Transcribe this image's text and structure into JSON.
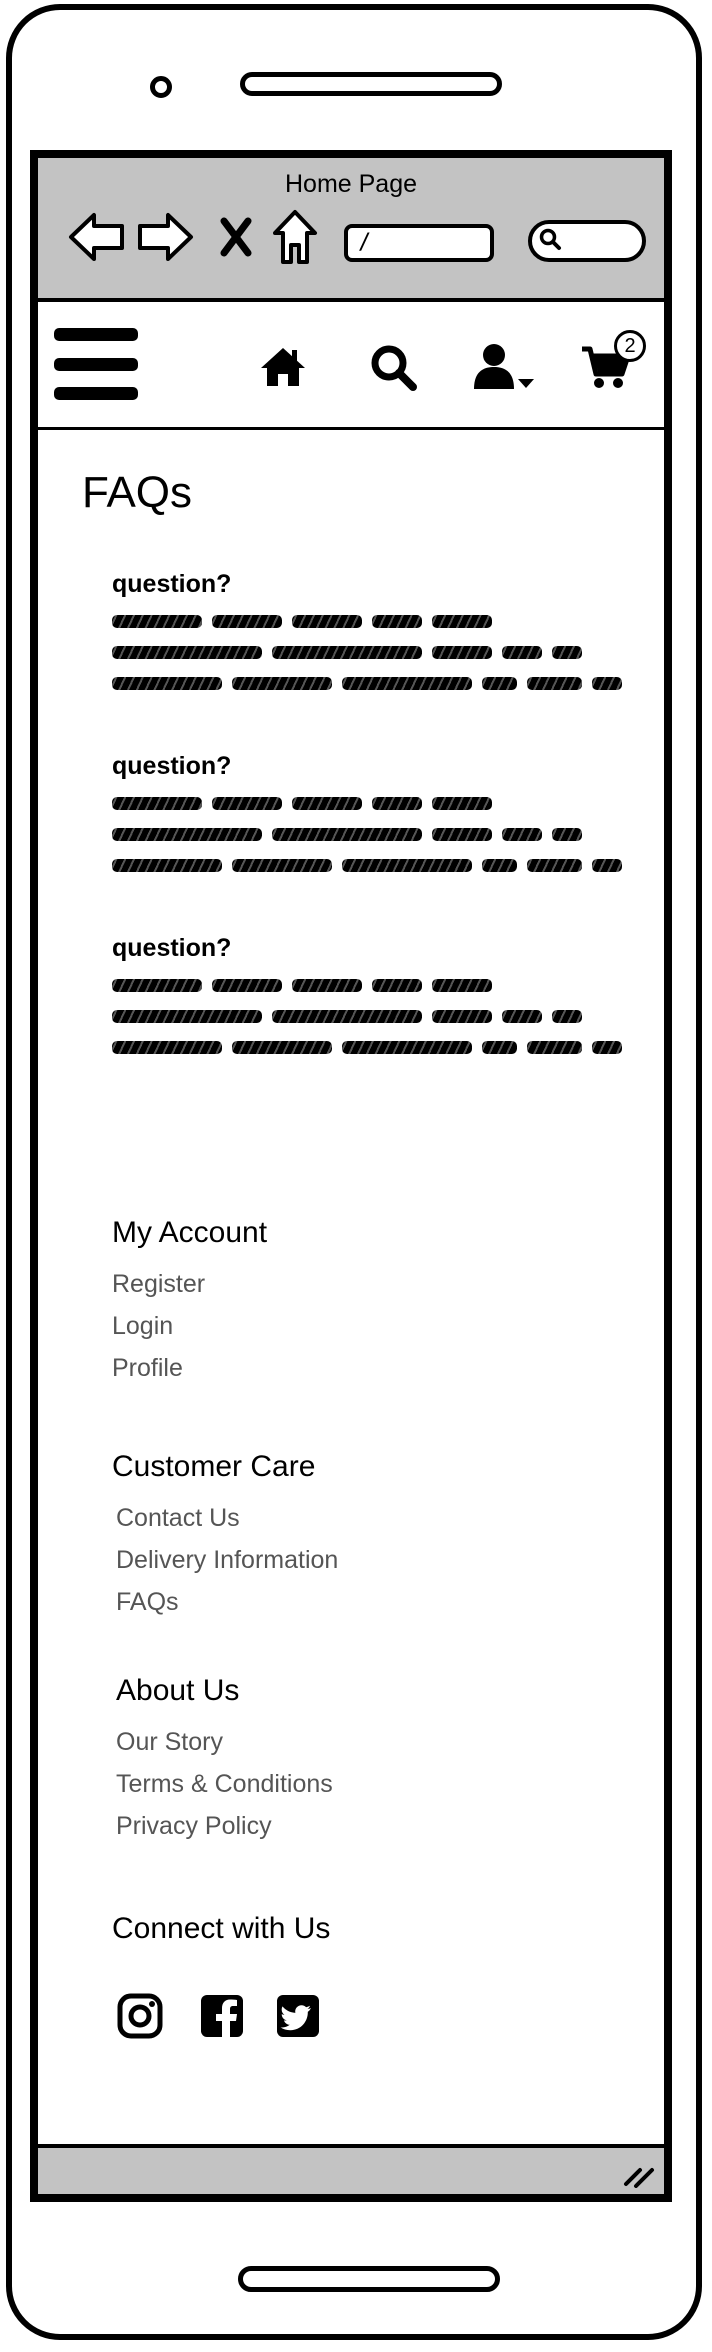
{
  "browser": {
    "title": "Home Page",
    "url": "/"
  },
  "header": {
    "cart_count": "2"
  },
  "page": {
    "title": "FAQs"
  },
  "faqs": [
    {
      "question": "question?"
    },
    {
      "question": "question?"
    },
    {
      "question": "question?"
    }
  ],
  "footer": {
    "my_account": {
      "heading": "My Account",
      "links": [
        "Register",
        "Login",
        "Profile"
      ]
    },
    "customer_care": {
      "heading": "Customer Care",
      "links": [
        "Contact Us",
        "Delivery Information",
        "FAQs"
      ]
    },
    "about_us": {
      "heading": "About Us",
      "links": [
        "Our Story",
        "Terms & Conditions",
        "Privacy Policy"
      ]
    },
    "connect": {
      "heading": "Connect with Us",
      "social": [
        "instagram-icon",
        "facebook-icon",
        "twitter-icon"
      ]
    }
  }
}
